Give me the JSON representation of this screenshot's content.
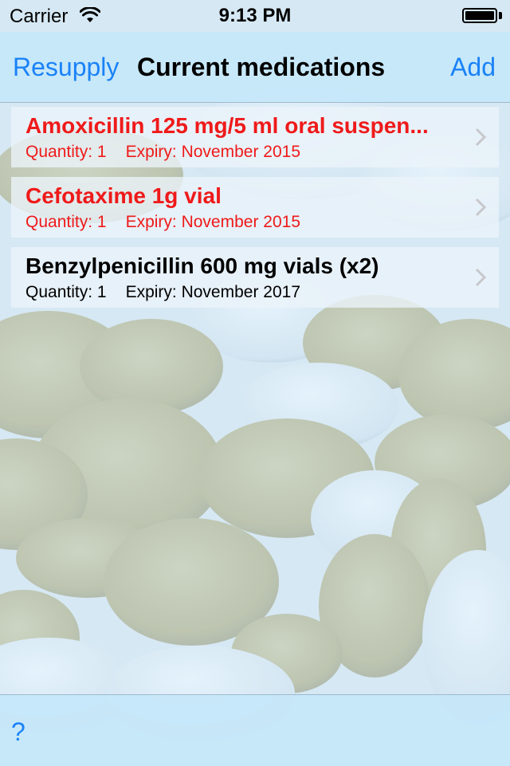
{
  "status_bar": {
    "carrier": "Carrier",
    "time": "9:13 PM",
    "battery_level": 1.0
  },
  "nav": {
    "left_button": "Resupply",
    "title": "Current medications",
    "right_button": "Add"
  },
  "medications": [
    {
      "name": "Amoxicillin 125 mg/5 ml oral suspen...",
      "quantity": "Quantity: 1",
      "expiry": "Expiry: November 2015",
      "status": "expired"
    },
    {
      "name": "Cefotaxime 1g vial",
      "quantity": "Quantity: 1",
      "expiry": "Expiry: November 2015",
      "status": "expired"
    },
    {
      "name": "Benzylpenicillin 600 mg vials (x2)",
      "quantity": "Quantity: 1",
      "expiry": "Expiry: November 2017",
      "status": "ok"
    }
  ],
  "toolbar": {
    "help_label": "?"
  },
  "colors": {
    "accent": "#1a82f7",
    "expired": "#ef1a1a",
    "ok": "#000000"
  }
}
